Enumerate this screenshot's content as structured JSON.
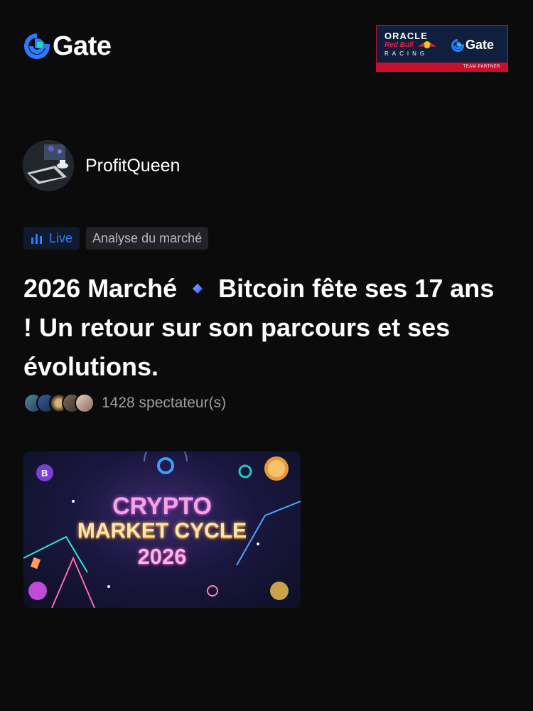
{
  "brand": {
    "name": "Gate",
    "accent": "#2f7bff"
  },
  "partner_badge": {
    "line1": "ORACLE",
    "line2": "Red Bull",
    "line3": "RACING",
    "brand": "Gate",
    "footer": "TEAM PARTNER"
  },
  "author": {
    "name": "ProfitQueen"
  },
  "tags": {
    "live": "Live",
    "topic": "Analyse du marché"
  },
  "post": {
    "title_part1": "2026 Marché",
    "title_part2": "Bitcoin fête ses 17 ans ! Un retour sur son parcours et ses évolutions."
  },
  "viewers": {
    "count_text": "1428 spectateur(s)"
  },
  "thumbnail": {
    "line1": "CRYPTO",
    "line2": "MARKET CYCLE",
    "line3": "2026"
  },
  "icons": [
    "gate-logo-icon",
    "live-chart-icon",
    "diamond-icon",
    "bitcoin-coin-icon"
  ]
}
